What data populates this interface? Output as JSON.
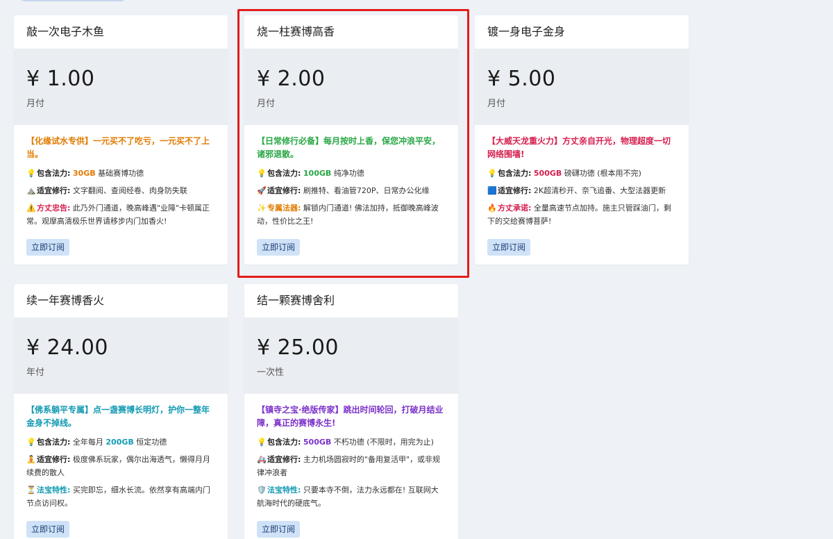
{
  "plans": [
    {
      "title": "敲一次电子木鱼",
      "price": "¥ 1.00",
      "period": "月付",
      "headline": "【化缘试水专供】一元买不了吃亏，一元买不了上当。",
      "features": [
        {
          "icon": "💡",
          "label": "包含法力:",
          "pre": " ",
          "highlight": "30GB",
          "post": " 基础赛博功德"
        },
        {
          "icon": "⛰️",
          "label": "适宜修行:",
          "pre": " 文字翻阅、查阅经卷、肉身防失联",
          "highlight": "",
          "post": ""
        },
        {
          "icon": "⚠️",
          "label": "方丈忠告:",
          "pre": " 此乃外门通道，晚高峰遇\"业障\"卡顿属正常。观摩高清极乐世界请移步内门加香火!",
          "highlight": "",
          "post": ""
        }
      ],
      "button": "立即订阅"
    },
    {
      "title": "烧一柱赛博高香",
      "price": "¥ 2.00",
      "period": "月付",
      "headline": "【日常修行必备】每月按时上香，保您冲浪平安，诸邪退散。",
      "features": [
        {
          "icon": "💡",
          "label": "包含法力:",
          "pre": " ",
          "highlight": "100GB",
          "post": " 纯净功德"
        },
        {
          "icon": "🚀",
          "label": "适宜修行:",
          "pre": " 刷推特、看油管720P、日常办公化缘",
          "highlight": "",
          "post": ""
        },
        {
          "icon": "✨",
          "label": "专属法器:",
          "pre": " 解锁内门通道! 佛法加持，抵御晚高峰波动，性价比之王!",
          "highlight": "",
          "post": ""
        }
      ],
      "button": "立即订阅"
    },
    {
      "title": "镀一身电子金身",
      "price": "¥ 5.00",
      "period": "月付",
      "headline": "【大威天龙重火力】方丈亲自开光，物理超度一切网络围墙!",
      "features": [
        {
          "icon": "💡",
          "label": "包含法力:",
          "pre": " ",
          "highlight": "500GB",
          "post": " 磅礴功德 (根本用不完)"
        },
        {
          "icon": "🟦",
          "label": "适宜修行:",
          "pre": " 2K超清秒开、奈飞追番、大型法器更新",
          "highlight": "",
          "post": ""
        },
        {
          "icon": "🔥",
          "label": "方丈承诺:",
          "pre": " 全量高速节点加持。施主只管踩油门，剩下的交给赛博菩萨!",
          "highlight": "",
          "post": ""
        }
      ],
      "button": "立即订阅"
    },
    {
      "title": "续一年赛博香火",
      "price": "¥ 24.00",
      "period": "年付",
      "headline": "【佛系躺平专属】点一盏赛博长明灯，护你一整年金身不掉线。",
      "features": [
        {
          "icon": "💡",
          "label": "包含法力:",
          "pre": " 全年每月 ",
          "highlight": "200GB",
          "post": " 恒定功德"
        },
        {
          "icon": "🧘",
          "label": "适宜修行:",
          "pre": " 极度佛系玩家，偶尔出海透气，懒得月月续费的散人",
          "highlight": "",
          "post": ""
        },
        {
          "icon": "⏳",
          "label": "法宝特性:",
          "pre": " 买完即忘，细水长流。依然享有高端内门节点访问权。",
          "highlight": "",
          "post": ""
        }
      ],
      "button": "立即订阅"
    },
    {
      "title": "结一颗赛博舍利",
      "price": "¥ 25.00",
      "period": "一次性",
      "headline": "【镇寺之宝·绝版传家】跳出时间轮回，打破月结业障，真正的赛博永生!",
      "features": [
        {
          "icon": "💡",
          "label": "包含法力:",
          "pre": " ",
          "highlight": "500GB",
          "post": " 不朽功德 (不限时，用完为止)"
        },
        {
          "icon": "🚑",
          "label": "适宜修行:",
          "pre": " 主力机场圆寂时的\"备用复活甲\"，或非规律冲浪者",
          "highlight": "",
          "post": ""
        },
        {
          "icon": "🛡️",
          "label": "法宝特性:",
          "pre": " 只要本寺不倒，法力永远都在! 互联网大航海时代的硬底气。",
          "highlight": "",
          "post": ""
        }
      ],
      "button": "立即订阅"
    }
  ]
}
